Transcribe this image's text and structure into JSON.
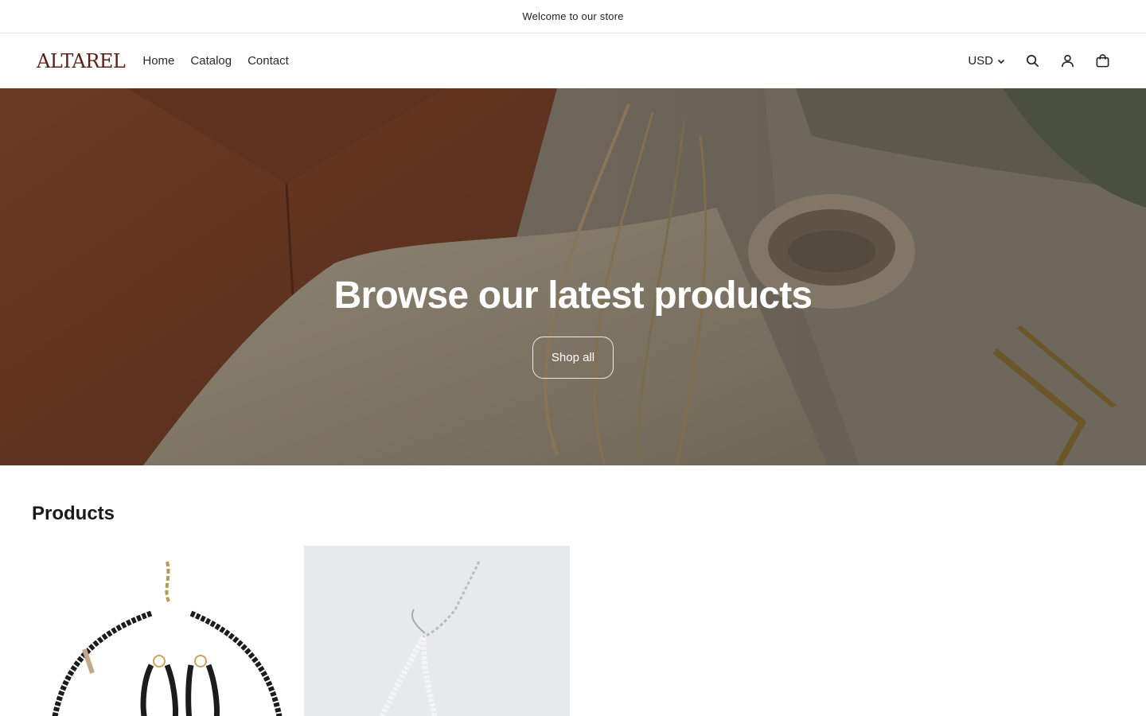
{
  "announcement": {
    "text": "Welcome to our store"
  },
  "header": {
    "logo_text": "ALTAREL",
    "nav": [
      {
        "label": "Home"
      },
      {
        "label": "Catalog"
      },
      {
        "label": "Contact"
      }
    ],
    "currency": "USD",
    "icons": [
      "search-icon",
      "account-icon",
      "cart-icon"
    ]
  },
  "hero": {
    "title": "Browse our latest products",
    "button_label": "Shop all"
  },
  "products": {
    "heading": "Products",
    "items": [
      {
        "image": "black-bead-necklace-earrings"
      },
      {
        "image": "white-bead-bracelet"
      }
    ]
  },
  "colors": {
    "logo": "#5a1f14",
    "hero_overlay": "rgba(0,0,0,0.25)"
  }
}
